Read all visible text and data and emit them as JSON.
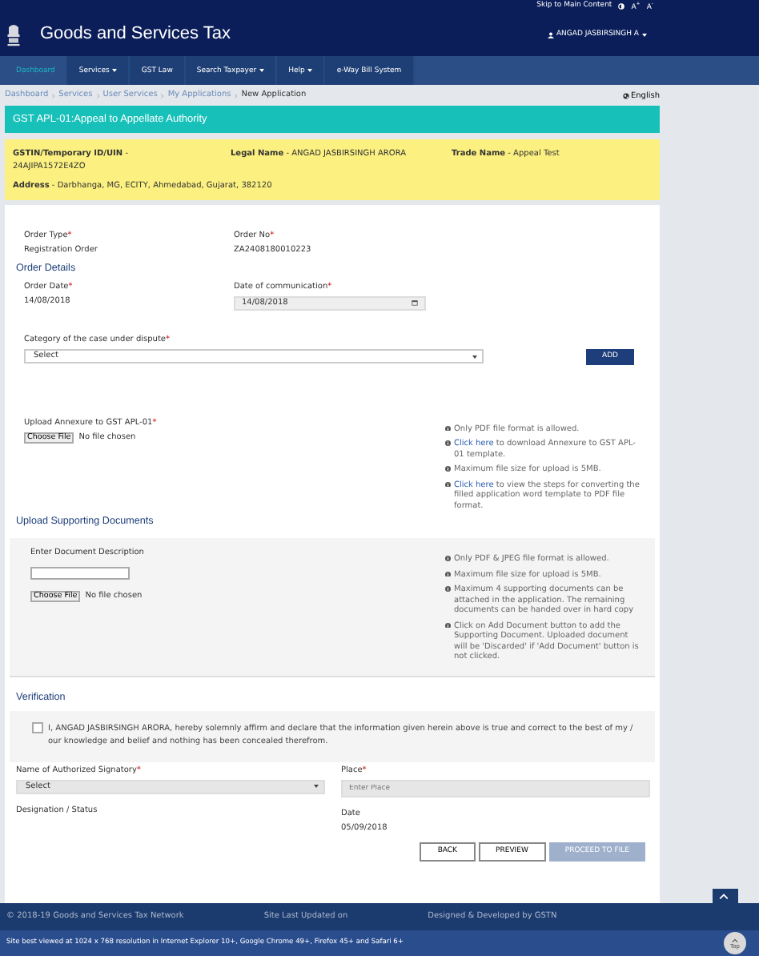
{
  "top_bar": {
    "skip_link": "Skip to Main Content",
    "font_larger": "A",
    "font_larger_sup": "+",
    "font_smaller": "A",
    "font_smaller_sup": "-"
  },
  "header": {
    "title": "Goods and Services Tax",
    "user": "ANGAD JASBIRSINGH A"
  },
  "nav": [
    {
      "label": "Dashboard",
      "selected": true,
      "dropdown": false
    },
    {
      "label": "Services",
      "selected": false,
      "dropdown": true
    },
    {
      "label": "GST Law",
      "selected": false,
      "dropdown": false
    },
    {
      "label": "Search Taxpayer",
      "selected": false,
      "dropdown": true
    },
    {
      "label": "Help",
      "selected": false,
      "dropdown": true
    },
    {
      "label": "e-Way Bill System",
      "selected": false,
      "dropdown": false
    }
  ],
  "breadcrumbs": [
    "Dashboard",
    "Services",
    "User Services",
    "My Applications",
    "New Application"
  ],
  "language": "English",
  "page_title": "GST APL-01:Appeal to Appellate Authority",
  "taxpayer": {
    "separator": "-",
    "gstin_label": "GSTIN/Temporary ID/UIN",
    "gstin": "24AJIPA1572E4ZO",
    "legal_name_label": "Legal Name",
    "legal_name": "ANGAD JASBIRSINGH ARORA",
    "trade_name_label": "Trade Name",
    "trade_name": "Appeal Test",
    "address_label": "Address",
    "address": "Darbhanga, MG, ECITY, Ahmedabad, Gujarat, 382120"
  },
  "order": {
    "type_label": "Order Type",
    "type": "Registration Order",
    "no_label": "Order No",
    "no": "ZA2408180010223",
    "required": "*"
  },
  "order_details": {
    "heading": "Order Details",
    "date_label": "Order Date",
    "date": "14/08/2018",
    "comm_label": "Date of communication",
    "comm_date": "14/08/2018",
    "category_label": "Category of the case under dispute",
    "category_value": "Select",
    "add_button": "ADD"
  },
  "annexure": {
    "label": "Upload Annexure to GST APL-01",
    "choose_button": "Choose File",
    "file_status": "No file chosen",
    "notes": [
      {
        "text": "Only PDF file format is allowed."
      },
      {
        "link": "Click here",
        "text": " to download Annexure to GST APL-01 template."
      },
      {
        "text": "Maximum file size for upload is 5MB."
      },
      {
        "link": "Click here",
        "text": " to view the steps for converting the filled application word template to PDF file format."
      }
    ]
  },
  "supporting": {
    "heading": "Upload Supporting Documents",
    "description_label": "Enter Document Description",
    "choose_button": "Choose File",
    "file_status": "No file chosen",
    "notes": [
      {
        "text": "Only PDF & JPEG file format is allowed."
      },
      {
        "text": "Maximum file size for upload is 5MB."
      },
      {
        "text": "Maximum 4 supporting documents can be attached in the application. The remaining documents can be handed over in hard copy"
      },
      {
        "text": "Click on Add Document button to add the Supporting Document. Uploaded document will be 'Discarded' if 'Add Document' button is not clicked."
      }
    ]
  },
  "verification": {
    "heading": "Verification",
    "checked": false,
    "declaration": "I, ANGAD JASBIRSINGH ARORA, hereby solemnly affirm and declare that the information given herein above is true and correct to the best of my / our knowledge and belief and nothing has been concealed therefrom.",
    "signatory_label": "Name of Authorized Signatory",
    "signatory_value": "Select",
    "place_label": "Place",
    "place_placeholder": "Enter Place",
    "designation_label": "Designation / Status",
    "date_label": "Date",
    "date": "05/09/2018"
  },
  "buttons": [
    {
      "label": "BACK",
      "disabled": false
    },
    {
      "label": "PREVIEW",
      "disabled": false
    },
    {
      "label": "PROCEED TO FILE",
      "disabled": true
    }
  ],
  "footer": {
    "copyright": "© 2018-19 Goods and Services Tax Network",
    "updated": "Site Last Updated on",
    "developed": "Designed & Developed by GSTN",
    "best_viewed": "Site best viewed at 1024 x 768 resolution in Internet Explorer 10+, Google Chrome 49+, Firefox 45+ and Safari 6+",
    "top_label": "Top"
  }
}
